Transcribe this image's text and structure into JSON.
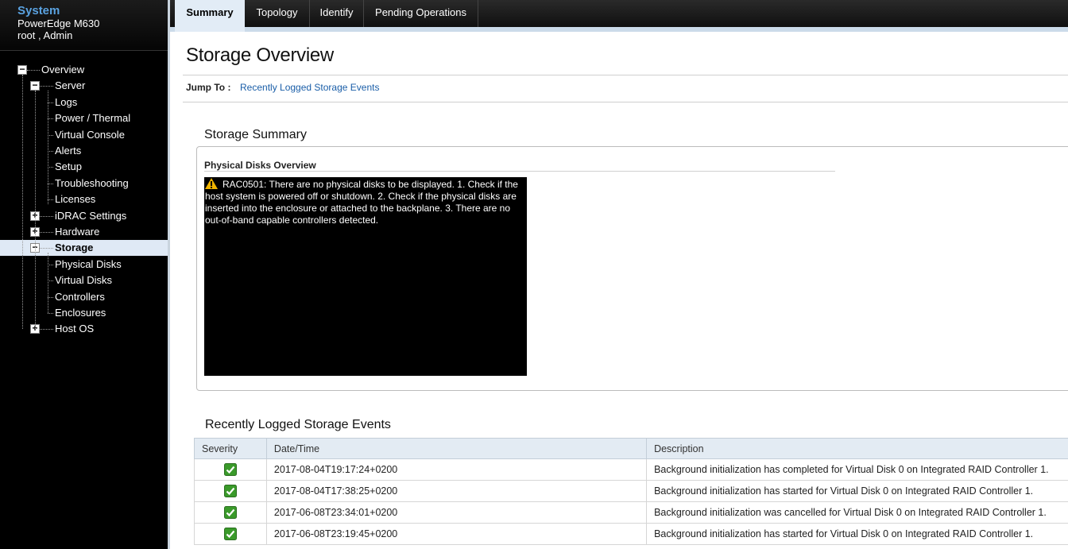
{
  "system": {
    "title": "System",
    "model": "PowerEdge M630",
    "user": "root , Admin"
  },
  "tree": [
    {
      "label": "Overview",
      "expander": "−"
    },
    {
      "label": "Server",
      "expander": "−"
    },
    {
      "label": "Logs"
    },
    {
      "label": "Power / Thermal"
    },
    {
      "label": "Virtual Console"
    },
    {
      "label": "Alerts"
    },
    {
      "label": "Setup"
    },
    {
      "label": "Troubleshooting"
    },
    {
      "label": "Licenses"
    },
    {
      "label": "iDRAC Settings",
      "expander": "+"
    },
    {
      "label": "Hardware",
      "expander": "+"
    },
    {
      "label": "Storage",
      "expander": "−",
      "selected": true
    },
    {
      "label": "Physical Disks"
    },
    {
      "label": "Virtual Disks"
    },
    {
      "label": "Controllers"
    },
    {
      "label": "Enclosures"
    },
    {
      "label": "Host OS",
      "expander": "+"
    }
  ],
  "tabs": [
    {
      "label": "Summary",
      "active": true
    },
    {
      "label": "Topology"
    },
    {
      "label": "Identify"
    },
    {
      "label": "Pending Operations"
    }
  ],
  "page": {
    "title": "Storage Overview",
    "jump_label": "Jump To :",
    "jump_link": "Recently Logged Storage Events"
  },
  "summary": {
    "title": "Storage Summary",
    "physical_disks_title": "Physical Disks Overview",
    "message": "RAC0501: There are no physical disks to be displayed. 1. Check if the host system is powered off or shutdown. 2. Check if the physical disks are inserted into the enclosure or attached to the backplane. 3. There are no out-of-band capable controllers detected."
  },
  "events": {
    "title": "Recently Logged Storage Events",
    "columns": [
      "Severity",
      "Date/Time",
      "Description"
    ],
    "rows": [
      {
        "severity": "ok-icon",
        "datetime": "2017-08-04T19:17:24+0200",
        "description": "Background initialization has completed for Virtual Disk 0 on Integrated RAID Controller 1."
      },
      {
        "severity": "ok-icon",
        "datetime": "2017-08-04T17:38:25+0200",
        "description": "Background initialization has started for Virtual Disk 0 on Integrated RAID Controller 1."
      },
      {
        "severity": "ok-icon",
        "datetime": "2017-06-08T23:34:01+0200",
        "description": "Background initialization was cancelled for Virtual Disk 0 on Integrated RAID Controller 1."
      },
      {
        "severity": "ok-icon",
        "datetime": "2017-06-08T23:19:45+0200",
        "description": "Background initialization has started for Virtual Disk 0 on Integrated RAID Controller 1."
      }
    ]
  },
  "colors": {
    "accent": "#5aa2e0",
    "link": "#1a5ea8",
    "ok": "#3a9a2a",
    "warning": "#f0b400"
  }
}
